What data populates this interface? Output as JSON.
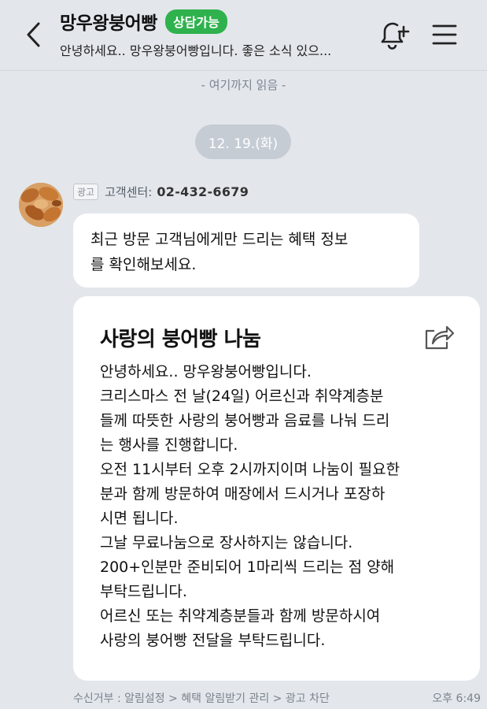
{
  "header": {
    "title": "망우왕붕어빵",
    "badge": "상담가능",
    "subtitle": "안녕하세요.. 망우왕붕어빵입니다. 좋은 소식 있으..."
  },
  "read_marker": "- 여기까지 읽음 -",
  "date": "12. 19.(화)",
  "message": {
    "ad_tag": "광고",
    "sender_label": "고객센터:",
    "sender_phone": "02-432-6679",
    "text_lines": [
      "최근 방문 고객님에게만 드리는 혜택 정보",
      "를 확인해보세요."
    ]
  },
  "card": {
    "title": "사랑의 붕어빵 나눔",
    "lines": [
      "안녕하세요.. 망우왕붕어빵입니다.",
      "크리스마스 전 날(24일) 어르신과 취약계층분",
      "들께 따뜻한 사랑의 붕어빵과 음료를 나눠 드리",
      "는 행사를 진행합니다.",
      "오전 11시부터 오후 2시까지이며 나눔이 필요한",
      "분과 함께 방문하여 매장에서 드시거나 포장하",
      "시면 됩니다.",
      "그날 무료나눔으로 장사하지는 않습니다.",
      "200+인분만 준비되어 1마리씩 드리는 점 양해",
      "부탁드립니다.",
      "어르신 또는 취약계층분들과 함께 방문하시여",
      "사랑의 붕어빵 전달을 부탁드립니다."
    ]
  },
  "footer": {
    "links": "수신거부 : 알림설정 > 혜택 알림받기 관리 > 광고 차단",
    "time": "오후 6:49"
  },
  "icons": {
    "back": "chevron-left-icon",
    "bell": "bell-plus-icon",
    "menu": "hamburger-menu-icon",
    "share": "share-icon"
  },
  "colors": {
    "background": "#e3e7ec",
    "badge": "#2fb24d",
    "bubble": "#ffffff"
  }
}
